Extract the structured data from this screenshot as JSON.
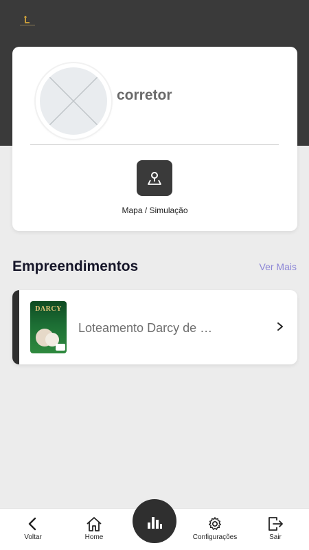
{
  "profile": {
    "name": "corretor"
  },
  "actions": {
    "map_label": "Mapa / Simulação"
  },
  "projects": {
    "title": "Empreendimentos",
    "see_more": "Ver Mais",
    "items": [
      {
        "name": "Loteamento Darcy de …",
        "thumb_title": "DARCY"
      }
    ]
  },
  "nav": {
    "back": "Voltar",
    "home": "Home",
    "settings": "Configurações",
    "logout": "Sair"
  },
  "colors": {
    "header": "#3a3a3a",
    "accent_link": "#8c86d6",
    "background": "#ececec"
  }
}
